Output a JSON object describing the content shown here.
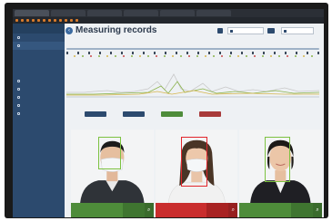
{
  "browser": {
    "tabs": [
      "",
      "",
      "",
      "",
      "",
      ""
    ],
    "bookmarks": [
      "",
      "",
      "",
      "",
      "",
      "",
      "",
      "",
      "",
      "",
      "",
      ""
    ]
  },
  "sidebar": {
    "brand": "",
    "items": [
      "",
      "",
      "",
      "",
      "",
      "",
      "",
      "",
      "",
      "",
      ""
    ]
  },
  "header": {
    "title": "Measuring records",
    "back_icon": "chevron-left-icon",
    "filter_icon": "filter-icon",
    "date_from": "",
    "date_to": ""
  },
  "timeline": {
    "start_label": "",
    "end_label": ""
  },
  "chart_colors": {
    "line_a": "#8ab34a",
    "line_b": "#d6b64c",
    "line_c": "#c8c8c8"
  },
  "buttons": [
    {
      "label": "",
      "color": "#2c4a6e"
    },
    {
      "label": "",
      "color": "#2c4a6e"
    },
    {
      "label": "",
      "color": "#4e8c3a"
    },
    {
      "label": "",
      "color": "#a83a3a"
    }
  ],
  "cards": [
    {
      "status": "ok",
      "line1": "",
      "line2": "",
      "side1": "",
      "side2": ""
    },
    {
      "status": "warn",
      "line1": "",
      "line2": "",
      "side1": "",
      "side2": ""
    },
    {
      "status": "ok",
      "line1": "",
      "line2": "",
      "side1": "",
      "side2": ""
    }
  ]
}
